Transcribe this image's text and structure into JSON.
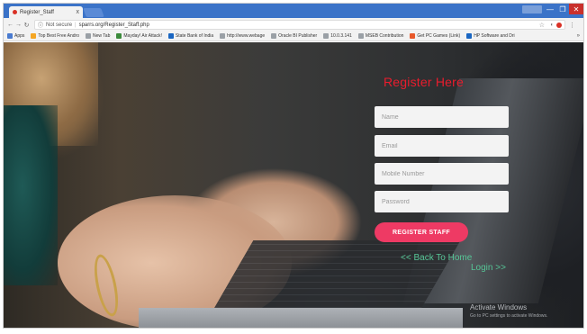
{
  "browser": {
    "tab_title": "Register_Staff",
    "tab_close": "x",
    "security_label": "Not secure",
    "separator": "|",
    "url": "sparrs.org/Register_Staff.php",
    "window_controls": {
      "minimize": "—",
      "maximize": "❐",
      "close": "✕"
    },
    "bookmarks": [
      {
        "label": "Apps",
        "color": "#4a7bd0"
      },
      {
        "label": "Top Best Free Andro",
        "color": "#f5a623"
      },
      {
        "label": "New Tab",
        "color": "#9aa0a6"
      },
      {
        "label": "Mayday! Air Attack!",
        "color": "#3c8b3c"
      },
      {
        "label": "State Bank of India",
        "color": "#1a66c2"
      },
      {
        "label": "http://www.webage",
        "color": "#9aa0a6"
      },
      {
        "label": "Oracle BI Publisher",
        "color": "#9aa0a6"
      },
      {
        "label": "10.0.3.141",
        "color": "#9aa0a6"
      },
      {
        "label": "MSEB Contribution",
        "color": "#9aa0a6"
      },
      {
        "label": "Get PC Games (Link)",
        "color": "#e8592b"
      },
      {
        "label": "HP Software and Dri",
        "color": "#1a66c2"
      }
    ],
    "bookmarks_more": "»"
  },
  "form": {
    "title": "Register Here",
    "name_placeholder": "Name",
    "email_placeholder": "Email",
    "mobile_placeholder": "Mobile Number",
    "password_placeholder": "Password",
    "submit_label": "REGISTER STAFF",
    "back_link": "<< Back To Home",
    "login_link": "Login >>"
  },
  "watermark": {
    "line1": "Activate Windows",
    "line2": "Go to PC settings to activate Windows."
  },
  "colors": {
    "title_red": "#ea1c2d",
    "button_pink": "#ee3a64",
    "link_green": "#56c596"
  }
}
